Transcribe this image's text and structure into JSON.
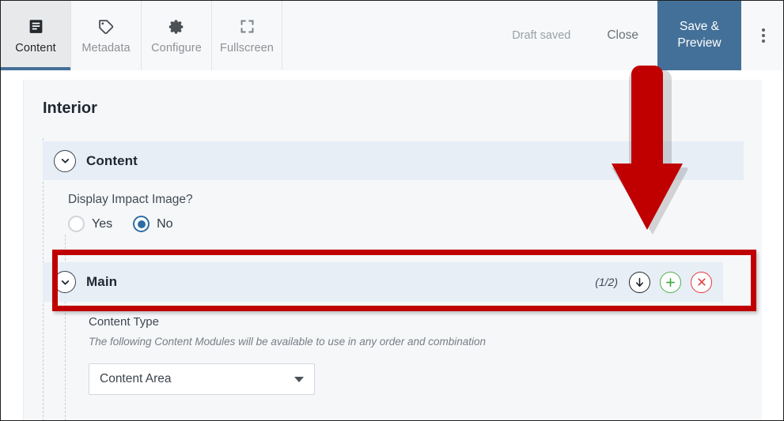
{
  "toolbar": {
    "tabs": [
      {
        "label": "Content",
        "icon": "document-icon",
        "active": true
      },
      {
        "label": "Metadata",
        "icon": "tag-icon",
        "active": false
      },
      {
        "label": "Configure",
        "icon": "gear-icon",
        "active": false
      },
      {
        "label": "Fullscreen",
        "icon": "fullscreen-icon",
        "active": false
      }
    ],
    "draft_status": "Draft saved",
    "close_label": "Close",
    "save_preview_label": "Save & Preview",
    "kebab_icon": "more-vertical-icon",
    "accent_blue": "#437098"
  },
  "page": {
    "title": "Interior"
  },
  "sections": {
    "content": {
      "title": "Content",
      "chevron_icon": "chevron-down-icon"
    },
    "main": {
      "title": "Main",
      "chevron_icon": "chevron-down-icon",
      "counter": "(1/2)",
      "actions": [
        {
          "name": "move-down-icon",
          "color": "#20262e"
        },
        {
          "name": "add-icon",
          "color": "#4cb04c"
        },
        {
          "name": "remove-icon",
          "color": "#e23b3b"
        }
      ]
    }
  },
  "fields": {
    "display_impact_image": {
      "label": "Display Impact Image?",
      "options": [
        {
          "label": "Yes",
          "selected": false
        },
        {
          "label": "No",
          "selected": true
        }
      ]
    },
    "content_type": {
      "label": "Content Type",
      "help": "The following Content Modules will be available to use in any order and combination",
      "selected": "Content Area"
    }
  },
  "annotations": {
    "highlight_color": "#c00000",
    "arrow_color": "#c00000",
    "arrow_direction": "down"
  }
}
